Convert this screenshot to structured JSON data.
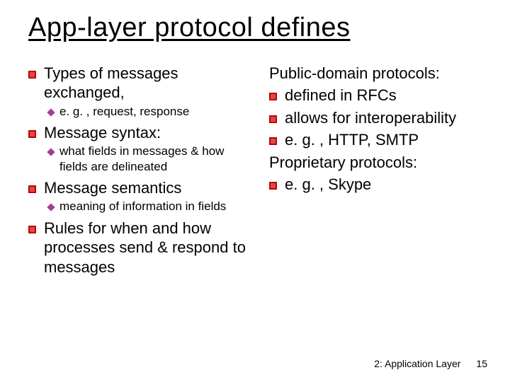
{
  "title": "App-layer protocol defines",
  "left": {
    "items": [
      {
        "text": "Types of messages exchanged,",
        "sub": [
          "e. g. , request, response"
        ]
      },
      {
        "text": "Message syntax:",
        "sub": [
          "what fields in messages & how fields are delineated"
        ]
      },
      {
        "text": "Message semantics",
        "sub": [
          "meaning of information in fields"
        ]
      },
      {
        "text": "Rules for when and how processes send & respond to messages",
        "sub": []
      }
    ]
  },
  "right": {
    "heading1": "Public-domain protocols:",
    "items1": [
      "defined in RFCs",
      "allows for interoperability",
      "e. g. , HTTP, SMTP"
    ],
    "heading2": "Proprietary protocols:",
    "items2": [
      "e. g. , Skype"
    ]
  },
  "footer": {
    "chapter": "2: Application Layer",
    "page": "15"
  }
}
